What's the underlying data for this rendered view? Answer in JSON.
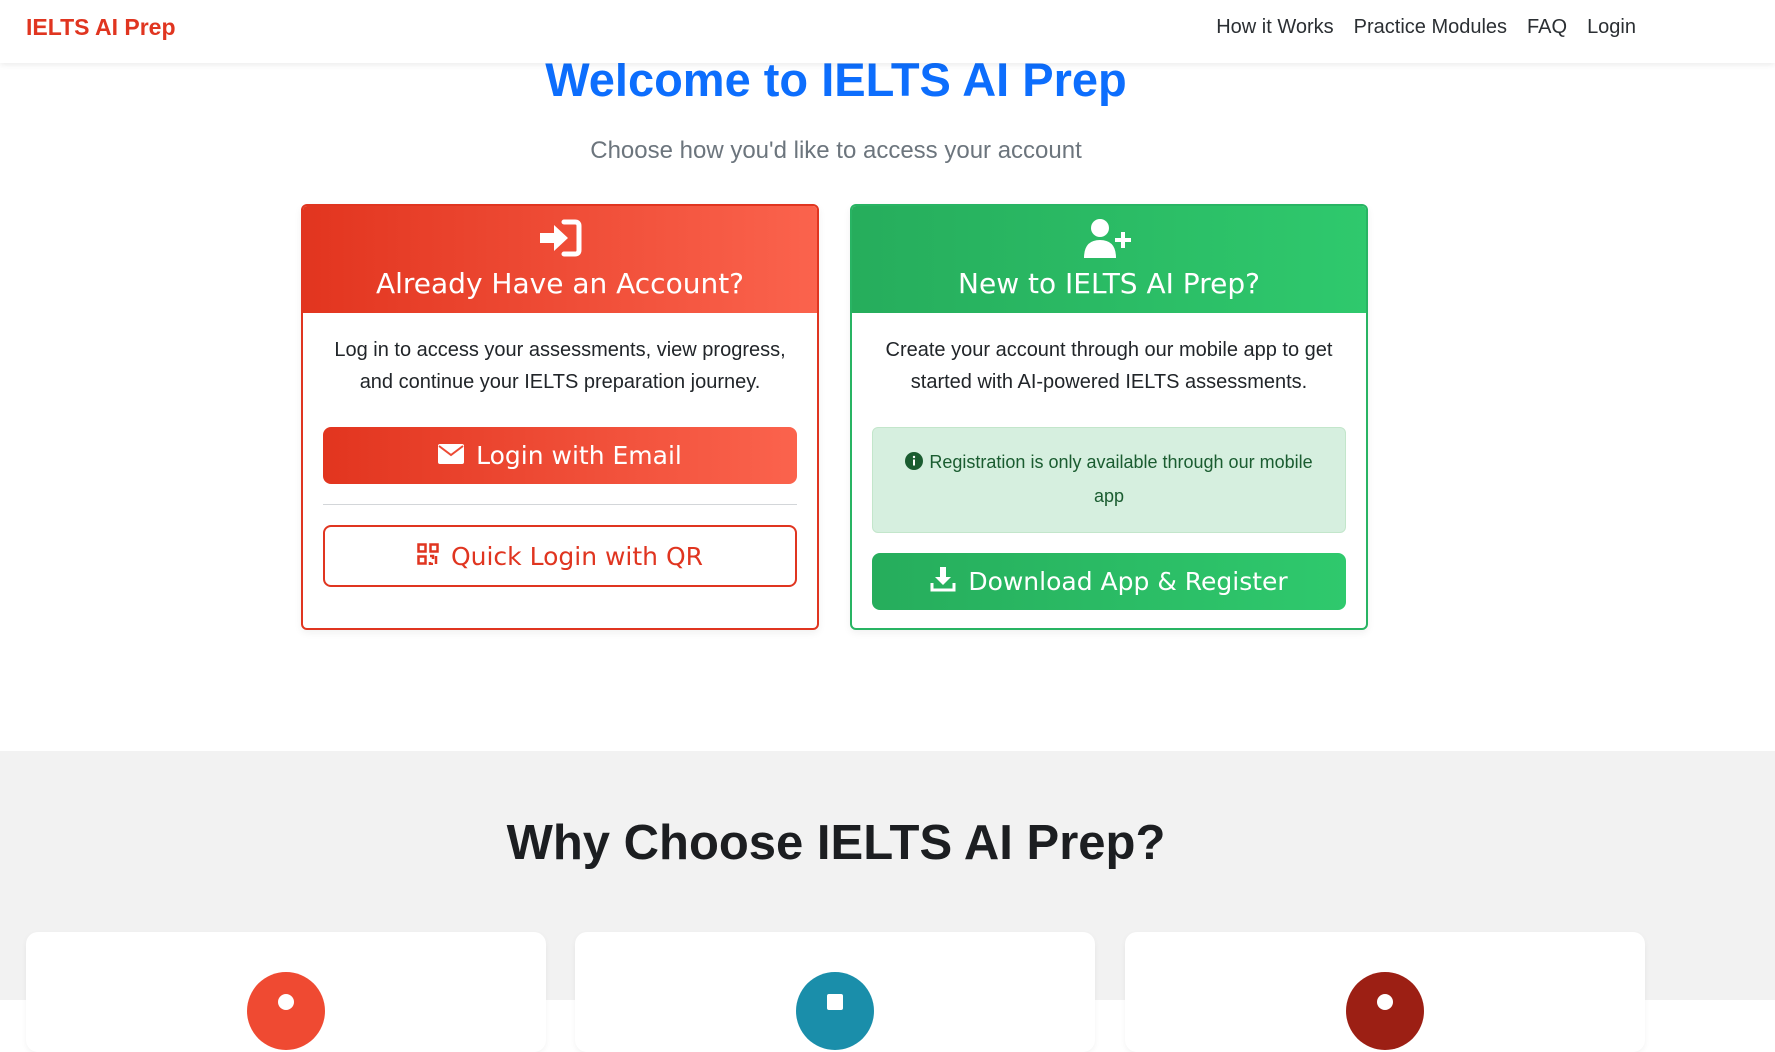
{
  "nav": {
    "brand": "IELTS AI Prep",
    "links": [
      "How it Works",
      "Practice Modules",
      "FAQ",
      "Login"
    ]
  },
  "hero": {
    "title": "Welcome to IELTS AI Prep",
    "subtitle": "Choose how you'd like to access your account"
  },
  "login_card": {
    "icon": "sign-in-icon",
    "heading": "Already Have an Account?",
    "text": "Log in to access your assessments, view progress, and continue your IELTS preparation journey.",
    "email_button": "Login with Email",
    "email_icon": "envelope-icon",
    "qr_button": "Quick Login with QR",
    "qr_icon": "qrcode-icon"
  },
  "register_card": {
    "icon": "user-plus-icon",
    "heading": "New to IELTS AI Prep?",
    "text": "Create your account through our mobile app to get started with AI-powered IELTS assessments.",
    "notice": "Registration is only available through our mobile app",
    "notice_icon": "info-circle-icon",
    "download_button": "Download App & Register",
    "download_icon": "download-icon"
  },
  "features": {
    "title": "Why Choose IELTS AI Prep?",
    "icon_colors": [
      "#ef4a32",
      "#1a8eaa",
      "#9c1f14"
    ]
  },
  "colors": {
    "brand": "#e03520",
    "primary_blue": "#0d6efd",
    "login_red": "#e2351f",
    "register_green": "#28b463"
  }
}
